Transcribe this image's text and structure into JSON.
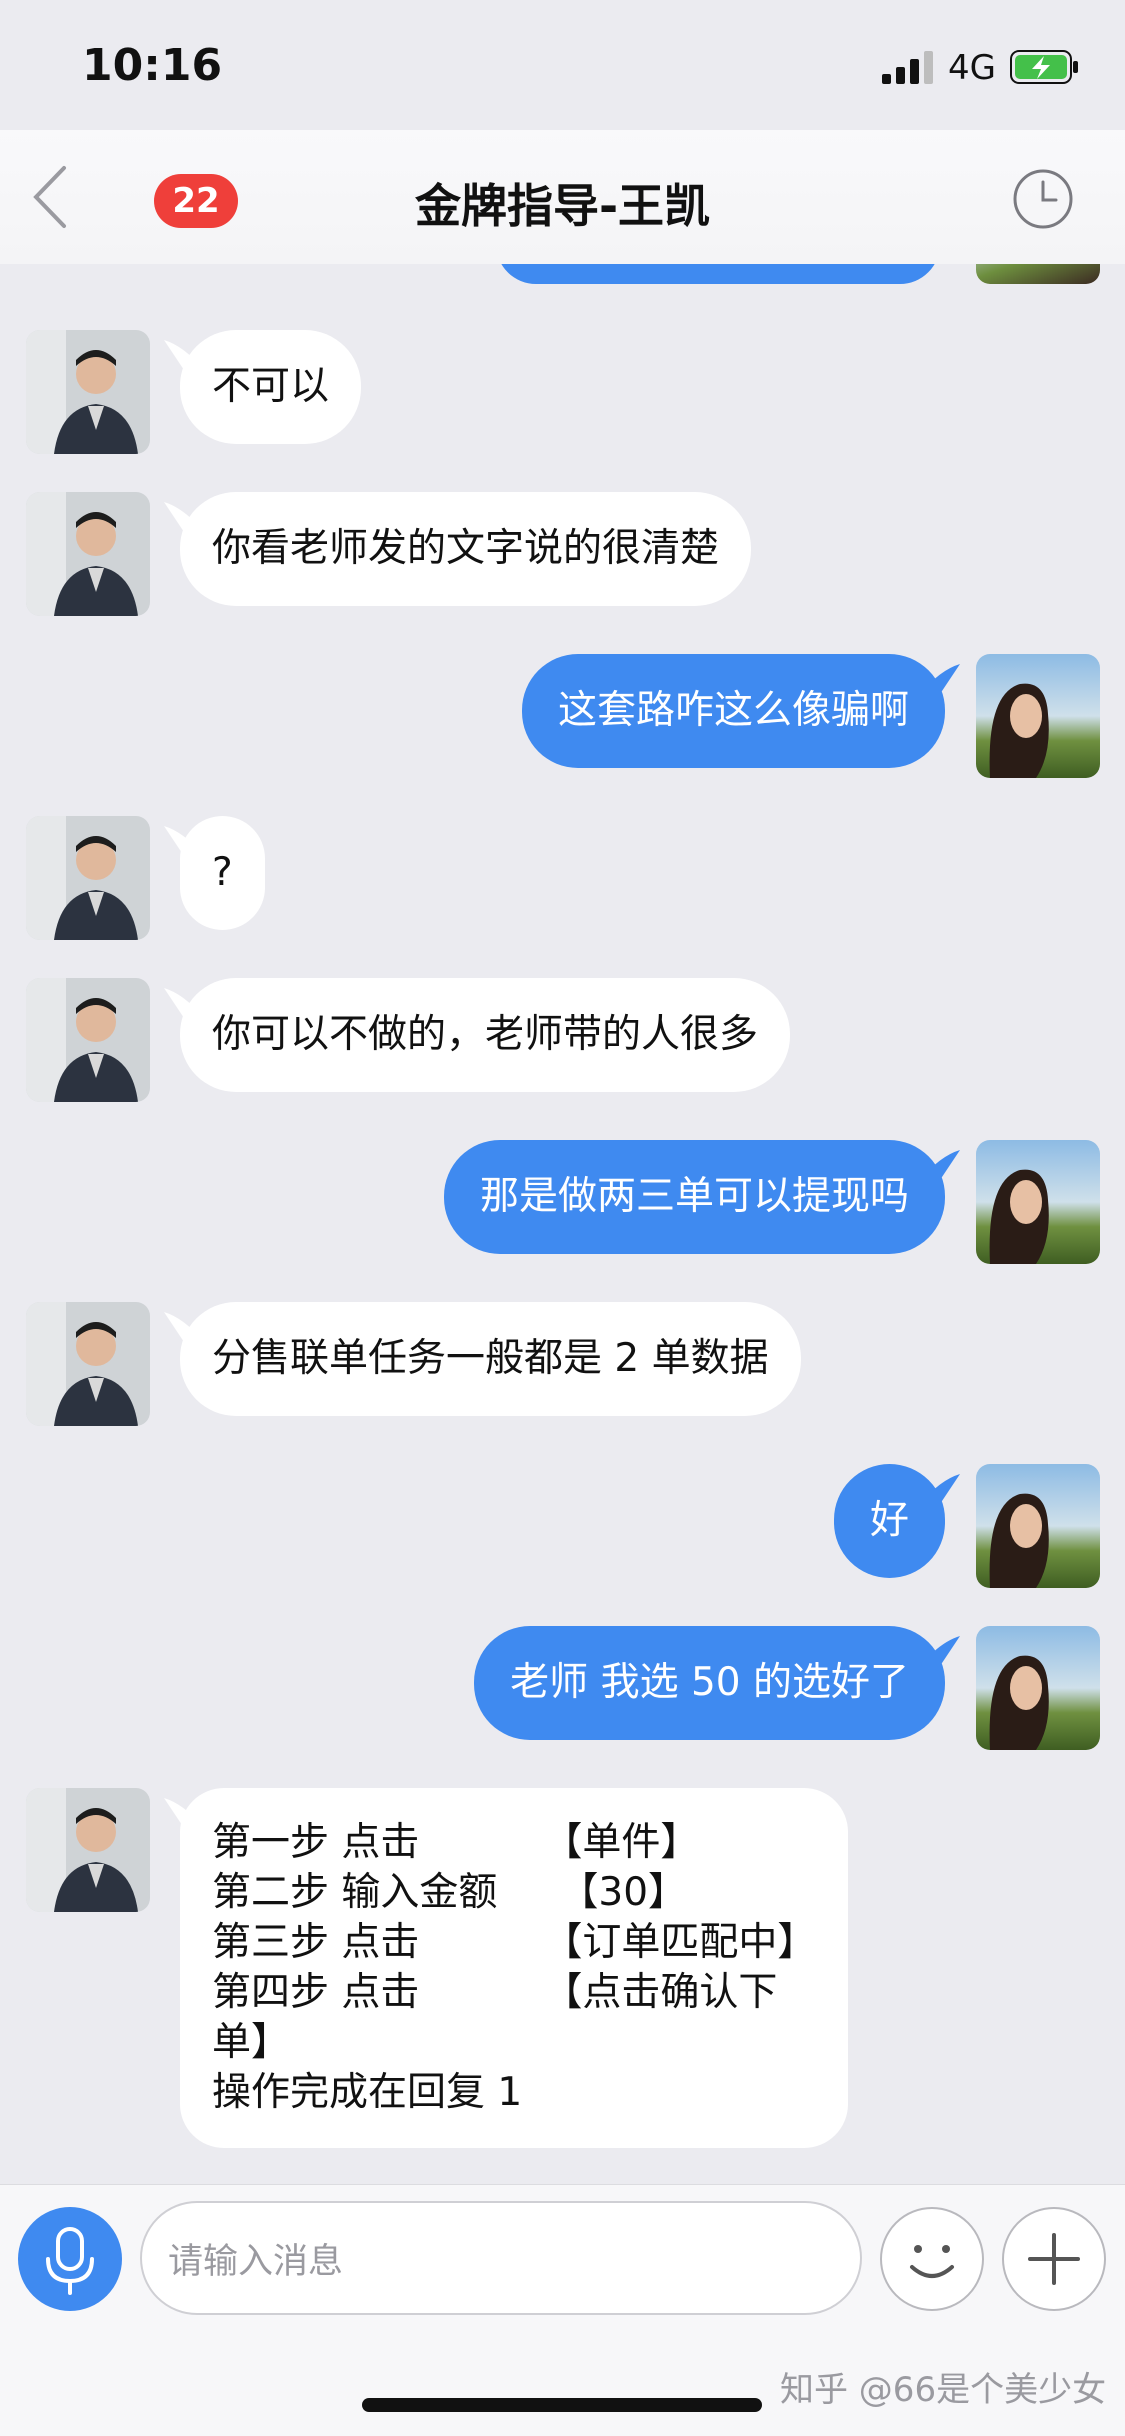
{
  "status": {
    "time": "10:16",
    "network": "4G"
  },
  "header": {
    "unread_badge": "22",
    "title": "金牌指导-王凯"
  },
  "messages": [
    {
      "side": "in",
      "text": "不可以"
    },
    {
      "side": "in",
      "text": "你看老师发的文字说的很清楚"
    },
    {
      "side": "out",
      "text": "这套路咋这么像骗啊"
    },
    {
      "side": "in",
      "text": "?"
    },
    {
      "side": "in",
      "text": "你可以不做的，老师带的人很多"
    },
    {
      "side": "out",
      "text": "那是做两三单可以提现吗"
    },
    {
      "side": "in",
      "text": "分售联单任务一般都是 2 单数据"
    },
    {
      "side": "out",
      "text": "好"
    },
    {
      "side": "out",
      "text": "老师 我选 50 的选好了"
    },
    {
      "side": "in",
      "text": "第一步 点击          【单件】\n第二步 输入金额     【30】\n第三步 点击          【订单匹配中】\n第四步 点击          【点击确认下\n单】\n操作完成在回复 1"
    }
  ],
  "input": {
    "placeholder": "请输入消息"
  },
  "watermark": "知乎 @66是个美少女",
  "colors": {
    "outgoing_bubble": "#3f8af0",
    "badge": "#ef3f3a",
    "background": "#ebebf0"
  },
  "icons": [
    "back-icon",
    "clock-icon",
    "mic-icon",
    "emoji-icon",
    "plus-icon"
  ]
}
